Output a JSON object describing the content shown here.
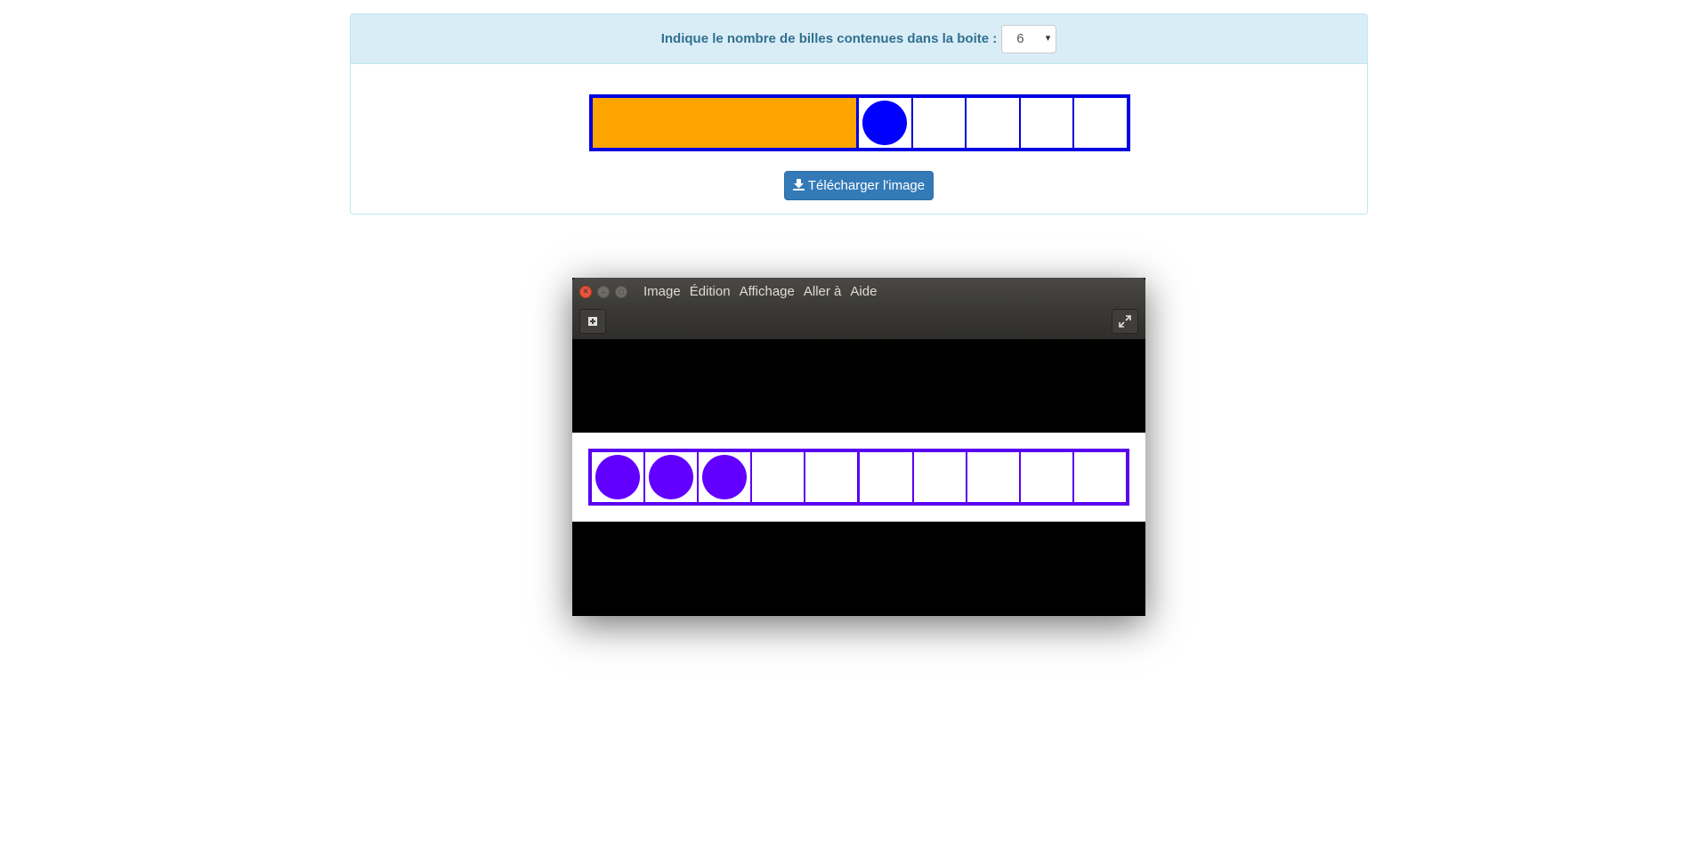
{
  "panel": {
    "prompt": "Indique le nombre de billes contenues dans la boite :",
    "select_value": "6",
    "select_caret": "▾",
    "download_label": "Télécharger l'image",
    "download_icon": "download-icon",
    "box": {
      "hidden_block_color": "#ffa500",
      "visible_cells": 5,
      "marbles_visible": 1,
      "marble_color": "#0000ff",
      "border_color": "#0000e0"
    }
  },
  "viewer": {
    "menu": [
      "Image",
      "Édition",
      "Affichage",
      "Aller à",
      "Aide"
    ],
    "toolbar": {
      "left_icon": "gallery-icon",
      "right_icon": "fullscreen-icon"
    },
    "image": {
      "cells": 10,
      "marbles": 3,
      "marble_color": "#6200ff",
      "border_color": "#5a00f0"
    }
  }
}
